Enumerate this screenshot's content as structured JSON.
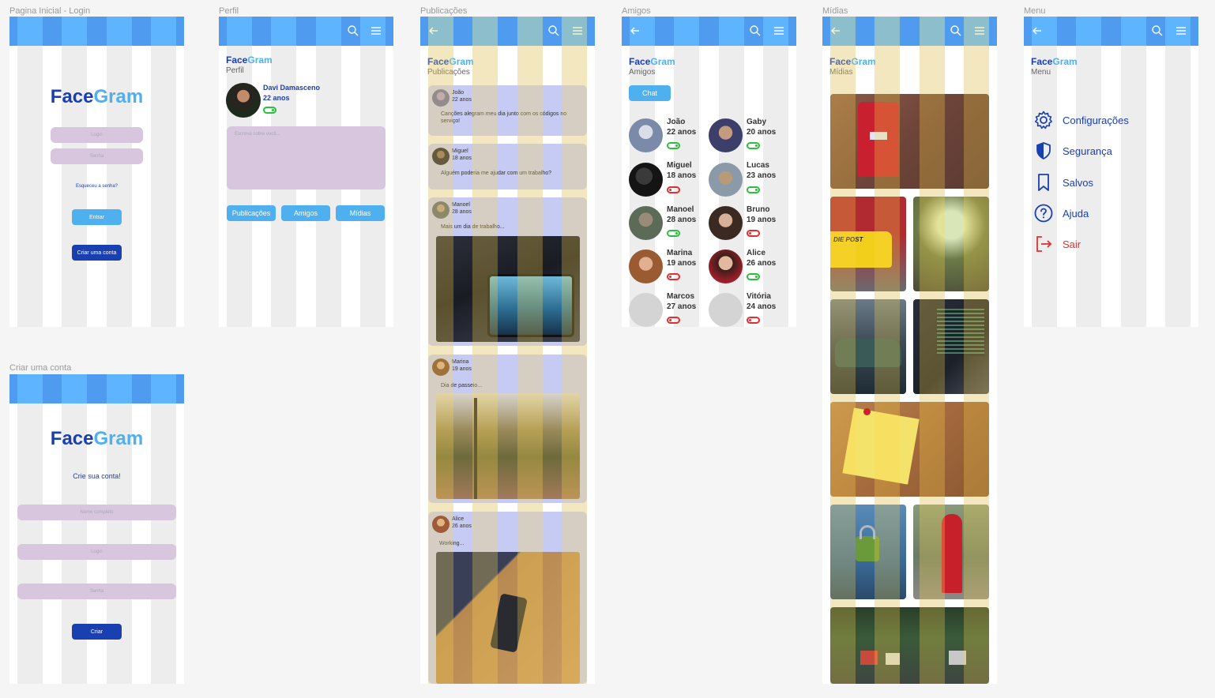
{
  "frames": {
    "login": {
      "label": "Pagina Inicial - Login",
      "brand": {
        "face": "Face",
        "gram": "Gram"
      },
      "login_placeholder": "Login",
      "password_placeholder": "Senha",
      "forgot_link": "Esqueceu a senha?",
      "enter_button": "Entrar",
      "create_account_button": "Criar uma conta"
    },
    "signup": {
      "label": "Criar uma conta",
      "brand": {
        "face": "Face",
        "gram": "Gram"
      },
      "heading": "Crie sua conta!",
      "name_placeholder": "Nome completo",
      "login_placeholder": "Login",
      "password_placeholder": "Senha",
      "create_button": "Criar"
    },
    "profile": {
      "label": "Perfil",
      "brand": {
        "face": "Face",
        "gram": "Gram"
      },
      "subtitle": "Perfil",
      "user_name": "Davi Damasceno",
      "user_age": "22 anos",
      "status": "on",
      "about_placeholder": "Escreva sobre você...",
      "tabs": [
        "Publicações",
        "Amigos",
        "Mídias"
      ]
    },
    "posts": {
      "label": "Publicações",
      "brand": {
        "face": "Face",
        "gram": "Gram"
      },
      "subtitle": "Publicações",
      "items": [
        {
          "name": "João",
          "age": "22 anos",
          "text": "Canções alegram meu dia junto com os códigos no serviço!",
          "image": "none"
        },
        {
          "name": "Miguel",
          "age": "18 anos",
          "text": "Alguém poderia me ajudar com um trabalho?",
          "image": "none"
        },
        {
          "name": "Manoel",
          "age": "28 anos",
          "text": "Mais um dia de trabalho...",
          "image": "video-editing-tablet"
        },
        {
          "name": "Marina",
          "age": "19 anos",
          "text": "Dia de passeio...",
          "image": "park-lamp-path"
        },
        {
          "name": "Alice",
          "age": "26 anos",
          "text": "Working...",
          "image": "card-terminal-on-table"
        }
      ]
    },
    "friends": {
      "label": "Amigos",
      "brand": {
        "face": "Face",
        "gram": "Gram"
      },
      "subtitle": "Amigos",
      "chat_button": "Chat",
      "items": [
        {
          "name": "João",
          "age": "22 anos",
          "status": "on"
        },
        {
          "name": "Gaby",
          "age": "20 anos",
          "status": "on"
        },
        {
          "name": "Miguel",
          "age": "18 anos",
          "status": "off"
        },
        {
          "name": "Lucas",
          "age": "23 anos",
          "status": "on"
        },
        {
          "name": "Manoel",
          "age": "28 anos",
          "status": "on"
        },
        {
          "name": "Bruno",
          "age": "19 anos",
          "status": "off"
        },
        {
          "name": "Marina",
          "age": "19 anos",
          "status": "off"
        },
        {
          "name": "Alice",
          "age": "26 anos",
          "status": "on"
        },
        {
          "name": "Marcos",
          "age": "27 anos",
          "status": "off"
        },
        {
          "name": "Vitória",
          "age": "24 anos",
          "status": "off"
        }
      ]
    },
    "media": {
      "label": "Mídias",
      "brand": {
        "face": "Face",
        "gram": "Gram"
      },
      "subtitle": "Mídias",
      "items": [
        "red-mailbox-wall",
        "yellow-post-van",
        "big-tree-roots",
        "green-car",
        "laptop-code",
        "lightbulb-sticky-note",
        "green-padlock",
        "red-pillar-box",
        "mailboxes-row"
      ],
      "van_text": "DIE POST"
    },
    "menu": {
      "label": "Menu",
      "brand": {
        "face": "Face",
        "gram": "Gram"
      },
      "subtitle": "Menu",
      "items": [
        {
          "label": "Configurações",
          "icon": "gear-icon"
        },
        {
          "label": "Segurança",
          "icon": "shield-icon"
        },
        {
          "label": "Salvos",
          "icon": "bookmark-icon"
        },
        {
          "label": "Ajuda",
          "icon": "help-icon"
        },
        {
          "label": "Sair",
          "icon": "logout-icon"
        }
      ]
    }
  },
  "colors": {
    "primary_dark": "#1a3fb0",
    "primary_light": "#4fb0f0",
    "topbar": "#4f9bf0",
    "online": "#2cbf3c",
    "offline": "#e0302f",
    "background": "#f5f5f5"
  }
}
